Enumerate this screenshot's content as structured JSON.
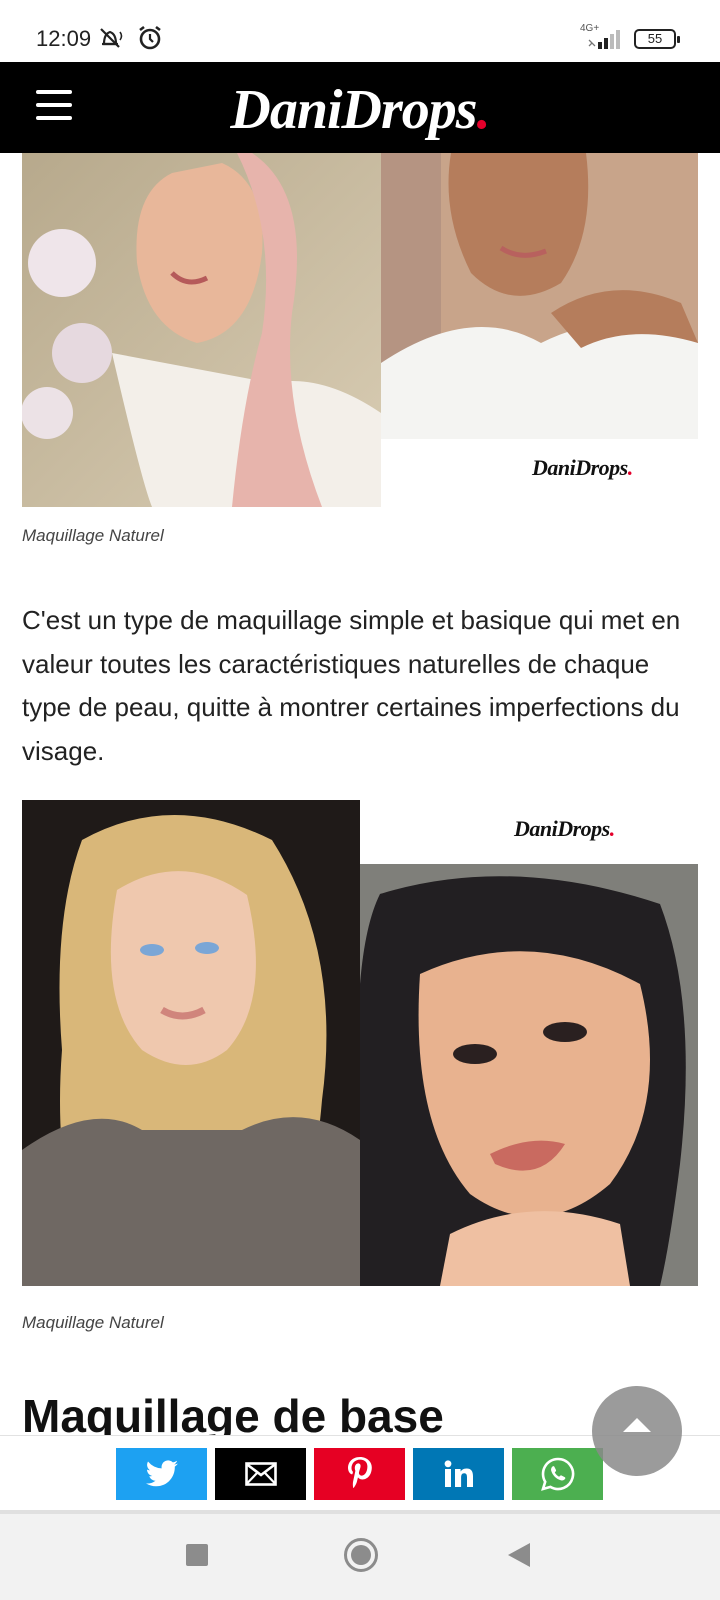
{
  "status_bar": {
    "time": "12:09",
    "network_type": "4G+",
    "battery": "55"
  },
  "header": {
    "logo_text": "DaniDrops",
    "logo_dot": ".",
    "logo_dot_color": "#e4002b"
  },
  "article": {
    "image1": {
      "left_photo": "woman-pink-headscarf-photo",
      "right_photo": "woman-white-shirt-photo",
      "watermark": "DaniDrops",
      "caption": "Maquillage Naturel"
    },
    "paragraph": "C'est un type de maquillage simple et basique qui met en valeur toutes les caractéristiques naturelles de chaque type de peau, quitte à montrer certaines imperfections du visage.",
    "image2": {
      "left_photo": "blonde-woman-photo",
      "right_photo": "dark-haired-woman-photo",
      "watermark": "DaniDrops",
      "caption": "Maquillage Naturel"
    },
    "next_heading": "Maquillage de base"
  },
  "share_bar": {
    "buttons": [
      {
        "network": "twitter",
        "icon": "twitter-bird-icon",
        "color": "#1da1f2"
      },
      {
        "network": "email",
        "icon": "envelope-icon",
        "color": "#000000"
      },
      {
        "network": "pinterest",
        "icon": "pinterest-p-icon",
        "color": "#e60023"
      },
      {
        "network": "linkedin",
        "icon": "linkedin-in-icon",
        "color": "#0077b5"
      },
      {
        "network": "whatsapp",
        "icon": "whatsapp-icon",
        "color": "#4caf50"
      }
    ]
  }
}
